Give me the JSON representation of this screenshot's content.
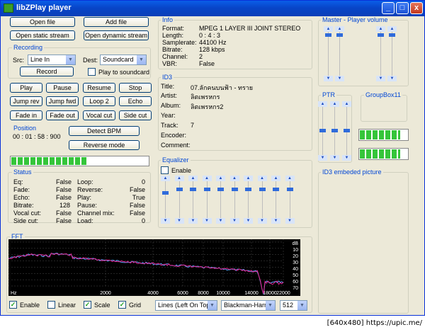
{
  "window": {
    "title": "libZPlay player",
    "min": "_",
    "max": "□",
    "close": "x"
  },
  "top_buttons": {
    "open_file": "Open file",
    "add_file": "Add file",
    "open_static": "Open static stream",
    "open_dynamic": "Open dynamic stream"
  },
  "recording": {
    "title": "Recording",
    "src_label": "Src:",
    "src_value": "Line In",
    "dest_label": "Dest:",
    "dest_value": "Soundcard",
    "record": "Record",
    "play_to_soundcard": "Play to soundcard"
  },
  "controls": [
    "Play",
    "Pause",
    "Resume",
    "Stop",
    "Jump rev",
    "Jump fwd",
    "Loop 2",
    "Echo",
    "Fade in",
    "Fade out",
    "Vocal cut",
    "Side cut"
  ],
  "position": {
    "title": "Position",
    "value": "00 : 01 : 58 : 900",
    "detect_bpm": "Detect BPM",
    "reverse_mode": "Reverse mode"
  },
  "progress": 0.55,
  "status_box": {
    "title": "Status",
    "left": [
      [
        "Eq:",
        "False"
      ],
      [
        "Fade:",
        "False"
      ],
      [
        "Echo:",
        "False"
      ],
      [
        "Bitrate:",
        "128"
      ],
      [
        "Vocal cut:",
        "False"
      ],
      [
        "Side cut:",
        "False"
      ]
    ],
    "right": [
      [
        "Loop:",
        "0"
      ],
      [
        "Reverse:",
        "False"
      ],
      [
        "Play:",
        "True"
      ],
      [
        "Pause:",
        "False"
      ],
      [
        "Channel mix:",
        "False"
      ],
      [
        "Load:",
        "0"
      ]
    ]
  },
  "info": {
    "title": "Info",
    "rows": [
      [
        "Format:",
        "MPEG 1 LAYER III JOINT STEREO"
      ],
      [
        "Length:",
        "0 : 4 : 3"
      ],
      [
        "Samplerate:",
        "44100 Hz"
      ],
      [
        "Bitrate:",
        "128 kbps"
      ],
      [
        "Channel:",
        "2"
      ],
      [
        "VBR:",
        "False"
      ]
    ]
  },
  "id3": {
    "title": "ID3",
    "rows": [
      [
        "Title:",
        "07.ลักคนบนฟ้า - ทราย"
      ],
      [
        "Artist:",
        "ลิตเพรหกร"
      ],
      [
        "Album:",
        "ลิตเพรหกร2"
      ],
      [
        "Year:",
        ""
      ],
      [
        "Track:",
        "7"
      ],
      [
        "Encoder:",
        ""
      ],
      [
        "Comment:",
        ""
      ]
    ]
  },
  "equalizer": {
    "title": "Equalizer",
    "enable": "Enable",
    "bands": [
      0.3,
      0.2,
      0.2,
      0.2,
      0.2,
      0.2,
      0.2,
      0.2,
      0.2,
      0.2
    ]
  },
  "master": {
    "title": "Master - Player volume"
  },
  "ptr": {
    "title": "PTR"
  },
  "groupbox11": {
    "title": "GroupBox11",
    "meter_levels": [
      0.85,
      0.85
    ]
  },
  "id3_picture": {
    "title": "ID3 embeded picture"
  },
  "fft": {
    "title": "FFT",
    "db_ticks": [
      "dB",
      "10",
      "20",
      "30",
      "40",
      "50",
      "60",
      "70"
    ],
    "x_ticks": [
      "Hz",
      "2000",
      "4000",
      "6000",
      "8000",
      "10000",
      "14000",
      "18000",
      "22000"
    ],
    "enable": "Enable",
    "linear": "Linear",
    "scale": "Scale",
    "grid": "Grid",
    "mode": "Lines (Left On Top)",
    "window_fn": "Blackman-Harris",
    "size": "512",
    "colors": {
      "left": "#e0208c",
      "right": "#5fa8ff",
      "grid": "#4a4a4a"
    }
  },
  "watermark": "[640x480] https://upic.me/"
}
